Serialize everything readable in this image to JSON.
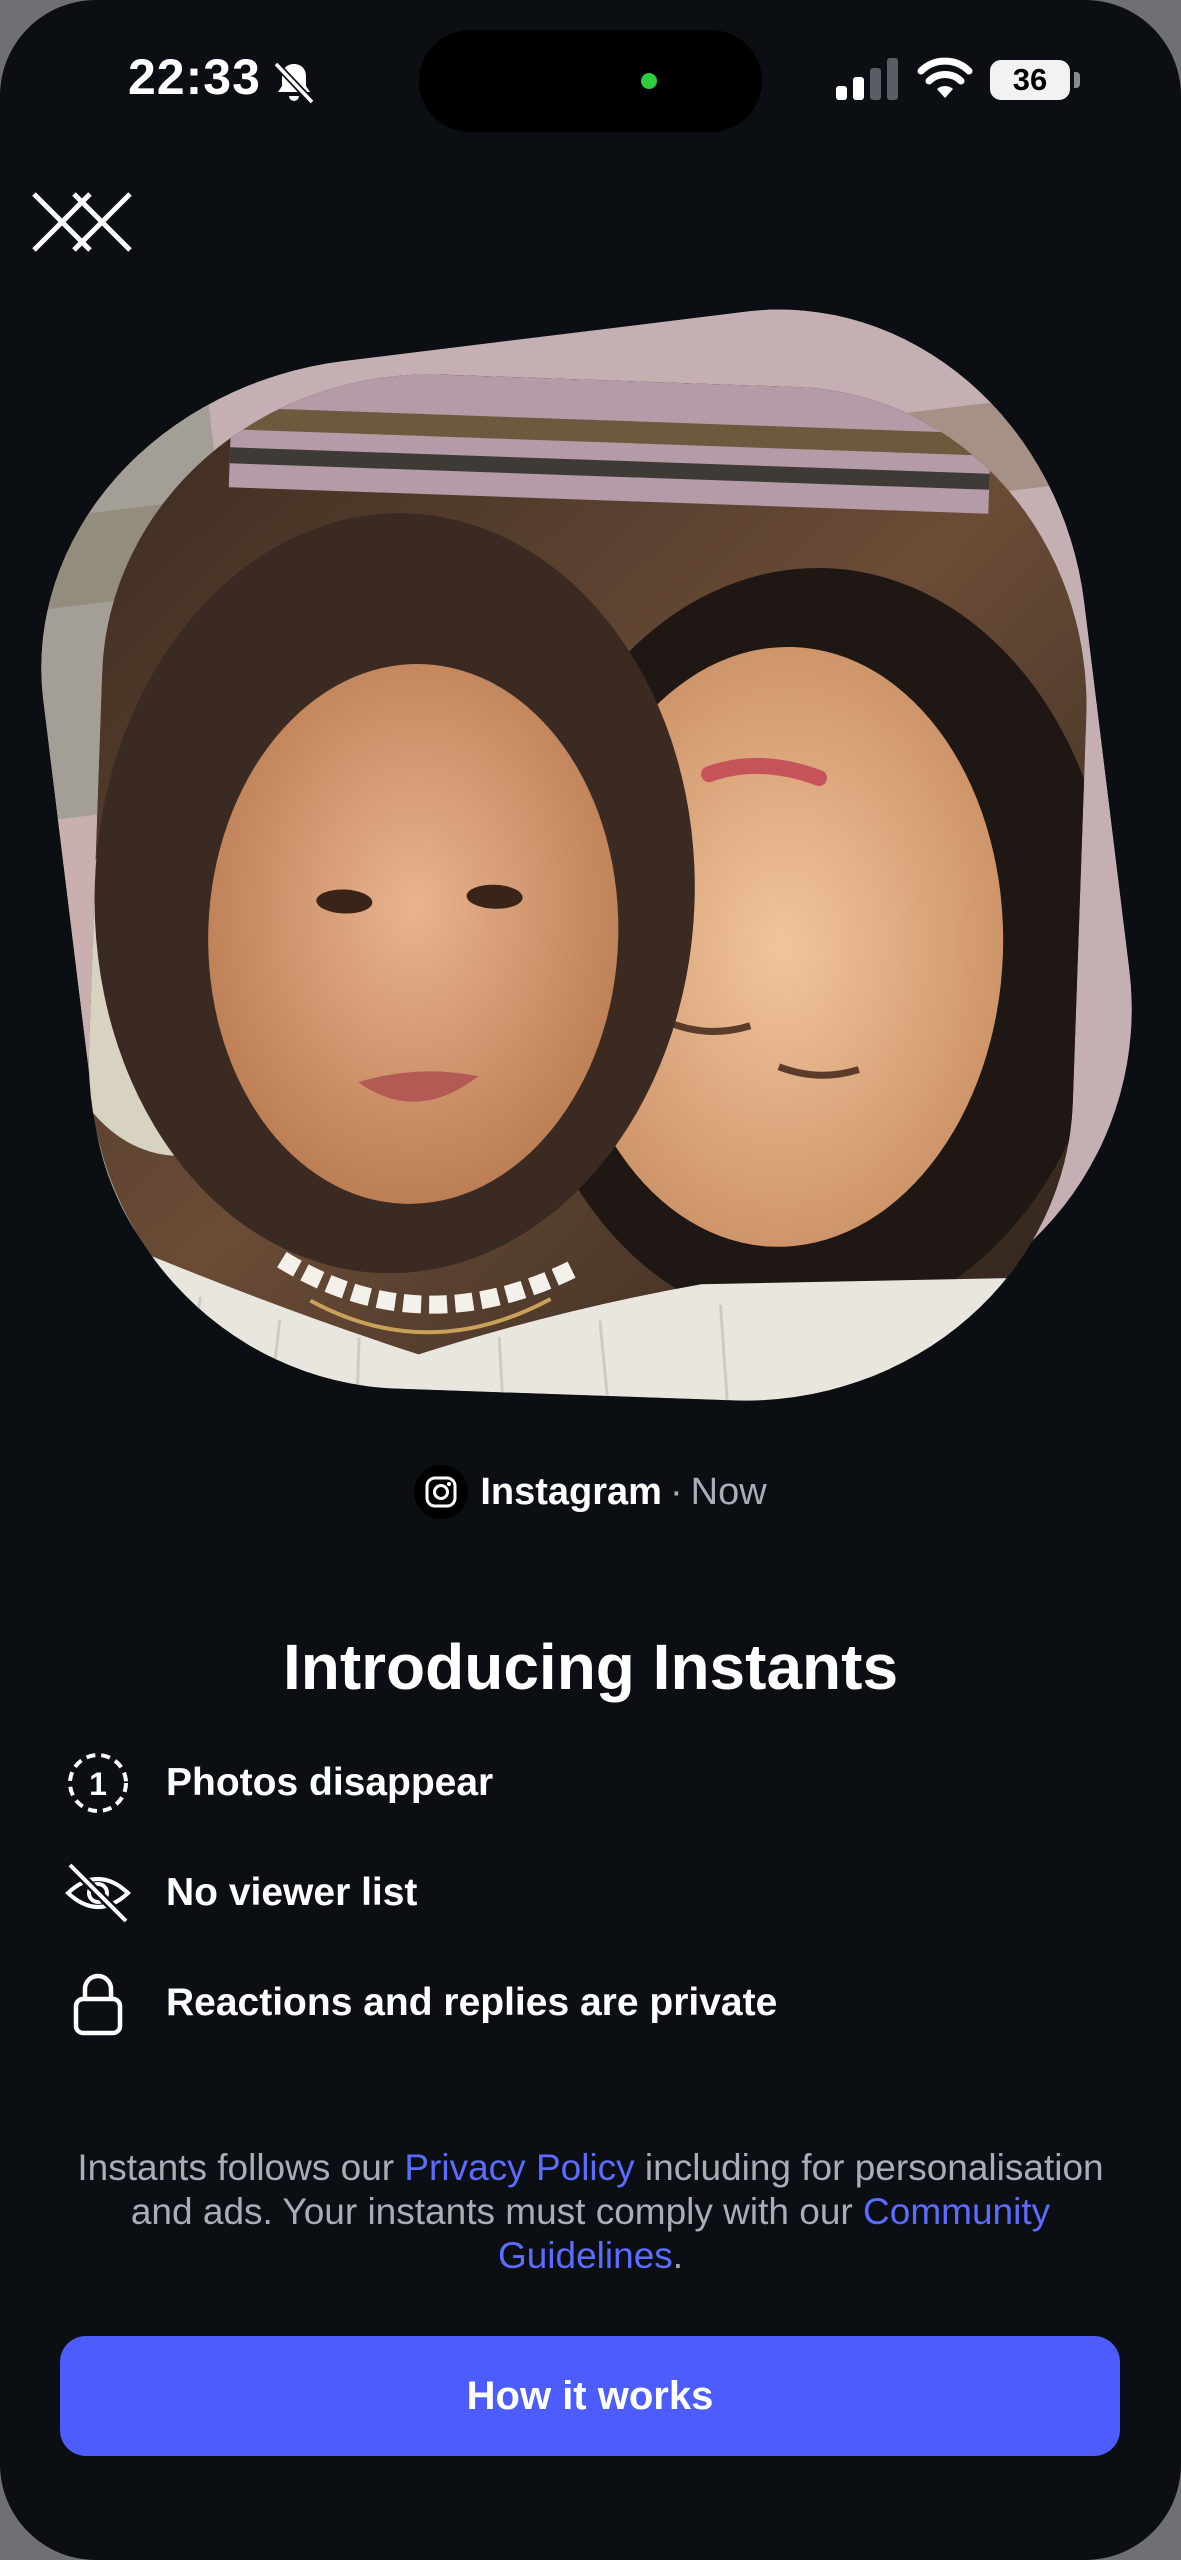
{
  "status_bar": {
    "time": "22:33",
    "battery_level": "36",
    "icons": [
      "bell-off-icon",
      "cellular-signal-icon",
      "wifi-icon",
      "battery-icon"
    ]
  },
  "close_icon": "close-icon",
  "photo": {
    "description_icon": "selfie-photo"
  },
  "source": {
    "app": "Instagram",
    "separator": "·",
    "time": "Now",
    "icon": "instagram-icon"
  },
  "headline": "Introducing Instants",
  "features": [
    {
      "icon": "timer-one-icon",
      "label": "Photos disappear"
    },
    {
      "icon": "eye-off-icon",
      "label": "No viewer list"
    },
    {
      "icon": "lock-icon",
      "label": "Reactions and replies are private"
    }
  ],
  "legal": {
    "part1": "Instants follows our ",
    "privacy_link": "Privacy Policy",
    "part2": " including for personalisation and ads. Your instants must comply with our ",
    "guidelines_link": "Community Guidelines",
    "part3": "."
  },
  "cta_label": "How it works",
  "colors": {
    "background": "#0b0e13",
    "accent": "#4c5cff",
    "link": "#5c6cff",
    "muted_text": "#a9adb6"
  }
}
